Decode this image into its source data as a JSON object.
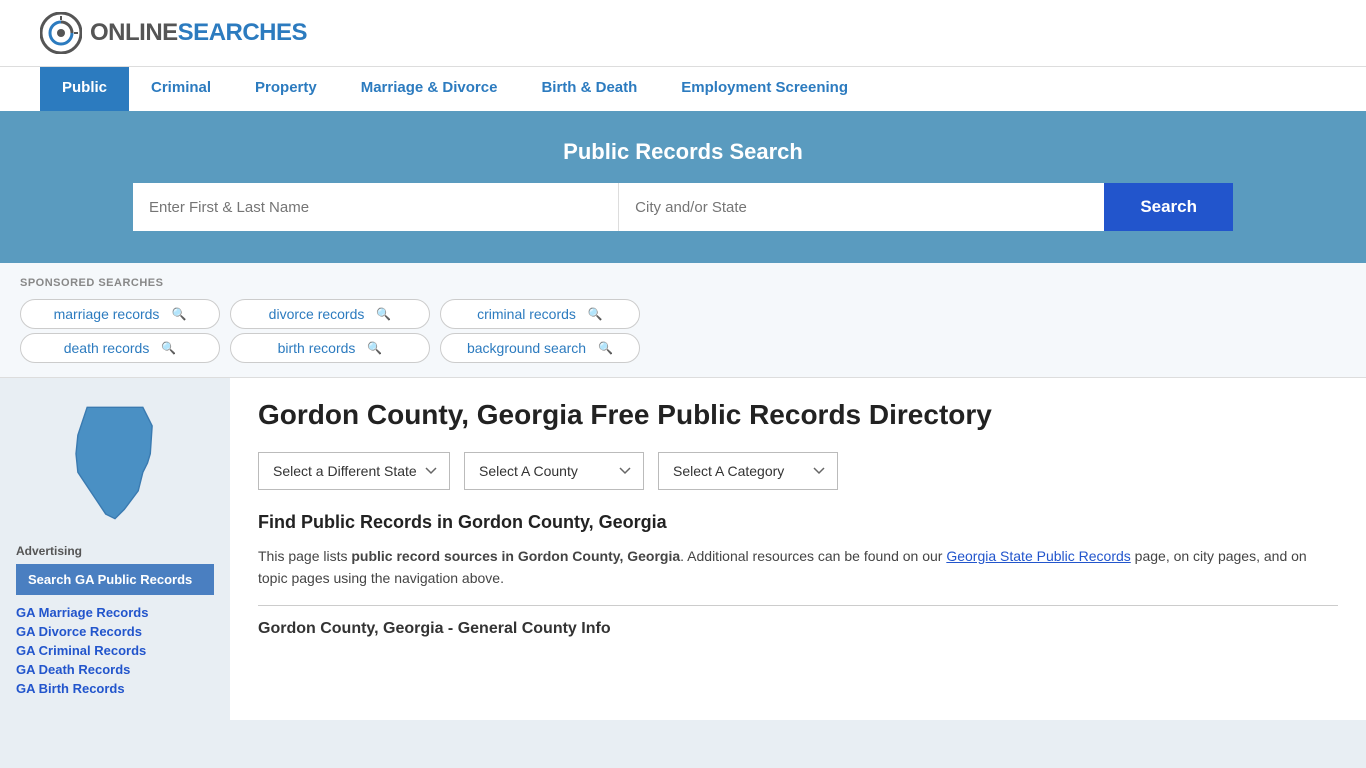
{
  "logo": {
    "text_online": "ONLINE",
    "text_searches": "SEARCHES"
  },
  "nav": {
    "items": [
      {
        "label": "Public",
        "active": true
      },
      {
        "label": "Criminal",
        "active": false
      },
      {
        "label": "Property",
        "active": false
      },
      {
        "label": "Marriage & Divorce",
        "active": false
      },
      {
        "label": "Birth & Death",
        "active": false
      },
      {
        "label": "Employment Screening",
        "active": false
      }
    ]
  },
  "search_banner": {
    "title": "Public Records Search",
    "name_placeholder": "Enter First & Last Name",
    "location_placeholder": "City and/or State",
    "button_label": "Search"
  },
  "sponsored": {
    "label": "SPONSORED SEARCHES",
    "pills": [
      {
        "label": "marriage records"
      },
      {
        "label": "divorce records"
      },
      {
        "label": "criminal records"
      },
      {
        "label": "death records"
      },
      {
        "label": "birth records"
      },
      {
        "label": "background search"
      }
    ]
  },
  "sidebar": {
    "ad_label": "Advertising",
    "ad_highlight": "Search GA Public Records",
    "links": [
      "GA Marriage Records",
      "GA Divorce Records",
      "GA Criminal Records",
      "GA Death Records",
      "GA Birth Records"
    ]
  },
  "main": {
    "page_title": "Gordon County, Georgia Free Public Records Directory",
    "dropdowns": {
      "state_label": "Select a Different State",
      "county_label": "Select A County",
      "category_label": "Select A Category"
    },
    "find_title": "Find Public Records in Gordon County, Georgia",
    "find_text_1": "This page lists ",
    "find_text_bold": "public record sources in Gordon County, Georgia",
    "find_text_2": ". Additional resources can be found on our ",
    "find_link": "Georgia State Public Records",
    "find_text_3": " page, on city pages, and on topic pages using the navigation above.",
    "county_info_header": "Gordon County, Georgia - General County Info"
  }
}
